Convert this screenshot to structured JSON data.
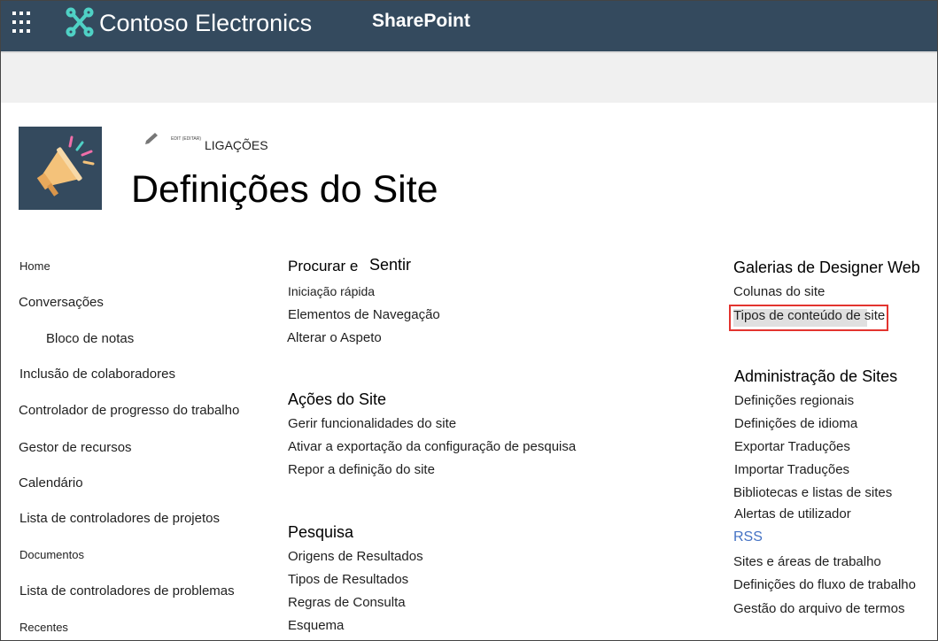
{
  "suite": {
    "brand": "Contoso Electronics",
    "product": "SharePoint"
  },
  "header": {
    "edit_tiny": "EDIT (EDITAR)",
    "ligacoes": "LIGAÇÕES",
    "title": "Definições do Site"
  },
  "nav": {
    "items": [
      "Home",
      "Conversações",
      "Bloco de notas",
      "Inclusão de colaboradores",
      "Controlador de progresso do trabalho",
      "Gestor de recursos",
      "Calendário",
      "Lista de controladores de projetos",
      "Documentos",
      "Lista de controladores de problemas",
      "Recentes"
    ]
  },
  "look": {
    "heading_a": "Procurar e",
    "heading_b": "Sentir",
    "links": [
      "Iniciação rápida",
      "Elementos de Navegação",
      "Alterar o Aspeto"
    ]
  },
  "actions": {
    "heading": "Ações do Site",
    "links": [
      "Gerir funcionalidades do site",
      "Ativar a exportação da configuração de pesquisa",
      "Repor a definição do site"
    ]
  },
  "search": {
    "heading": "Pesquisa",
    "links": [
      "Origens de Resultados",
      "Tipos de Resultados",
      "Regras de Consulta",
      "Esquema"
    ]
  },
  "galleries": {
    "heading": "Galerias de Designer Web",
    "links": [
      "Colunas do site",
      "Tipos de conteúdo de site"
    ]
  },
  "admin": {
    "heading": "Administração de Sites",
    "links": [
      "Definições regionais",
      "Definições de idioma",
      "Exportar Traduções",
      "Importar Traduções",
      "Bibliotecas e listas de sites",
      "Alertas de utilizador",
      "RSS",
      "Sites e áreas de trabalho",
      "Definições do fluxo de trabalho",
      "Gestão do arquivo de termos"
    ]
  },
  "colors": {
    "suitebar": "#344a5e",
    "highlight_border": "#e3342f",
    "rss_link": "#4472c4"
  }
}
